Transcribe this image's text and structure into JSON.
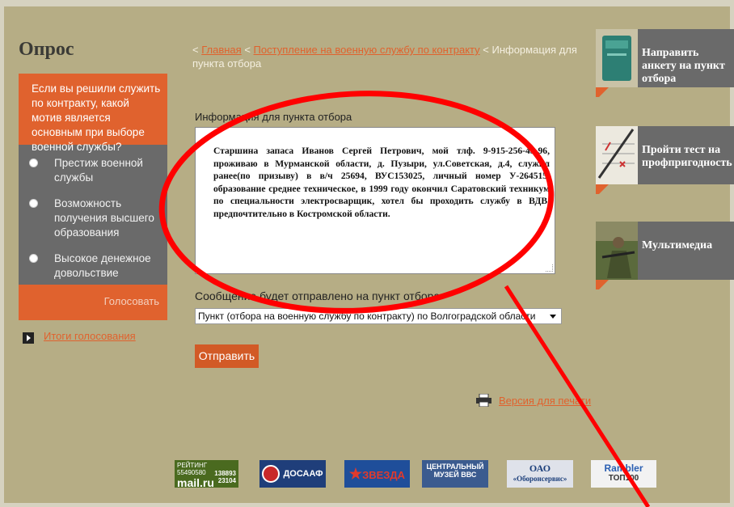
{
  "poll": {
    "title": "Опрос",
    "question": "Если вы решили служить по контракту, какой мотив является основным при выборе военной службы?",
    "options": [
      "Престиж военной службы",
      "Возможность получения высшего образования",
      "Высокое денежное довольствие"
    ],
    "vote_label": "Голосовать",
    "results_label": "Итоги голосования"
  },
  "breadcrumb": {
    "home": "Главная",
    "section": "Поступление на военную службу по контракту",
    "current": "Информация для пункта отбора",
    "separator": "<"
  },
  "form": {
    "label": "Информация для пункта отбора",
    "message": "Старшина запаса Иванов Сергей Петрович, мой тлф. 9-915-256-45-96, проживаю в Мурманской области, д. Пузыри, ул.Советская, д.4, служил ранее(по призыву) в в/ч 25694, ВУС153025, личный номер У-264515, образование среднее техническое, в 1999 году окончил Саратовский техникум по специальности электросварщик, хотел бы проходить службу в ВДВ, предпочтительно в Костромской области.",
    "send_to_label": "Сообщение будет отправлено на пункт отбора",
    "selected_point": "Пункт (отбора на военную службу по контракту) по Волгоградской области",
    "submit_label": "Отправить",
    "print_label": "Версия для печати"
  },
  "right_panels": [
    {
      "label": "Направить анкету на пункт отбора",
      "icon": "id-card-icon"
    },
    {
      "label": "Пройти тест на профпригодность",
      "icon": "test-form-icon"
    },
    {
      "label": "Мультимедиа",
      "icon": "soldier-photo-icon"
    }
  ],
  "footer_logos": [
    {
      "name": "mail-ru-counter",
      "text_top": "РЕЙТИНГ 55490580",
      "brand": "mail.ru",
      "numbers": "138893\n23104"
    },
    {
      "name": "dosaaf-logo",
      "text": "ДОСААФ"
    },
    {
      "name": "zvezda-logo",
      "text": "ЗВЕЗДА"
    },
    {
      "name": "museum-logo",
      "text_top": "ЦЕНТРАЛЬНЫЙ",
      "text_bottom": "МУЗЕЙ ВВС"
    },
    {
      "name": "oboronservis-logo",
      "text_top": "ОАО",
      "text_bottom": "«Оборонсервис»"
    },
    {
      "name": "rambler-logo",
      "text_top": "Rambler",
      "text_bottom": "ТОП100"
    }
  ],
  "colors": {
    "page_bg": "#b6ad85",
    "accent": "#e0622e",
    "panel_gray": "#6a6a6a",
    "annotation_red": "#ff0000"
  }
}
